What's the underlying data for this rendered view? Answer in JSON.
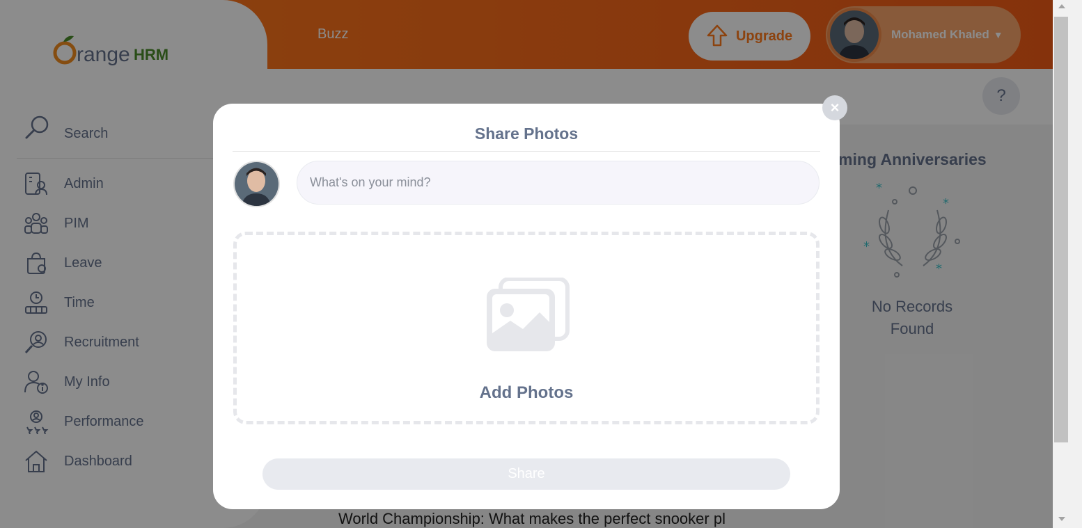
{
  "header": {
    "module_title": "Buzz",
    "upgrade_label": "Upgrade",
    "user_name": "Mohamed Khaled",
    "help_label": "?"
  },
  "sidebar": {
    "logo_text": "OrangeHRM",
    "search_label": "Search",
    "items": [
      {
        "label": "Admin",
        "icon": "admin-icon"
      },
      {
        "label": "PIM",
        "icon": "pim-icon"
      },
      {
        "label": "Leave",
        "icon": "leave-icon"
      },
      {
        "label": "Time",
        "icon": "time-icon"
      },
      {
        "label": "Recruitment",
        "icon": "recruitment-icon"
      },
      {
        "label": "My Info",
        "icon": "my-info-icon"
      },
      {
        "label": "Performance",
        "icon": "performance-icon"
      },
      {
        "label": "Dashboard",
        "icon": "dashboard-icon"
      }
    ]
  },
  "anniversaries": {
    "title": "oming Anniversaries",
    "empty_text": "No Records Found"
  },
  "feed": {
    "post_excerpt": "World Championship: What makes the perfect snooker pl"
  },
  "modal": {
    "title": "Share Photos",
    "input_placeholder": "What's on your mind?",
    "add_photos_label": "Add Photos",
    "share_label": "Share",
    "close_label": "×"
  },
  "colors": {
    "brand_orange": "#ff7b1d",
    "text_slate": "#64728c",
    "muted_bg": "#e8eaef"
  }
}
